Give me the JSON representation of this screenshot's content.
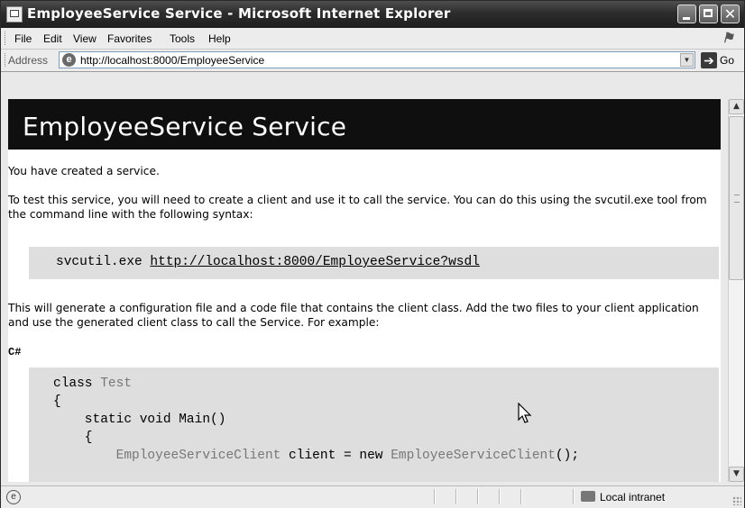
{
  "window": {
    "title": "EmployeeService Service - Microsoft Internet Explorer",
    "minimize_icon": "minimize-icon",
    "maximize_icon": "maximize-icon",
    "close_icon": "close-icon",
    "close_glyph": "✕"
  },
  "menu": {
    "items": [
      {
        "label": "File"
      },
      {
        "label": "Edit"
      },
      {
        "label": "View"
      },
      {
        "label": "Favorites"
      },
      {
        "label": "Tools"
      },
      {
        "label": "Help"
      }
    ]
  },
  "address": {
    "label": "Address",
    "url": "http://localhost:8000/EmployeeService",
    "go_label": "Go",
    "go_glyph": "➔",
    "dropdown_glyph": "▼"
  },
  "page": {
    "heading": "EmployeeService Service",
    "intro": "You have created a service.",
    "test_text": "To test this service, you will need to create a client and use it to call the service. You can do this using the svcutil.exe tool from the command line with the following syntax:",
    "cmd_tool": "svcutil.exe ",
    "cmd_url": "http://localhost:8000/EmployeeService?wsdl",
    "generate_text": "This will generate a configuration file and a code file that contains the client class. Add the two files to your client application and use the generated client class to call the Service. For example:",
    "language_label": "C#",
    "code": {
      "line1_kw": "class ",
      "line1_name": "Test",
      "line2": "{",
      "line3": "    static void Main()",
      "line4": "    {",
      "line5_indent": "        ",
      "line5_type": "EmployeeServiceClient",
      "line5_mid": " client = new ",
      "line5_ctor": "EmployeeServiceClient",
      "line5_end": "();"
    }
  },
  "scrollbar": {
    "up_glyph": "▲",
    "down_glyph": "▼",
    "position": 0.0
  },
  "status": {
    "zone": "Local intranet",
    "page_icon_glyph": "e"
  },
  "colors": {
    "header_bg": "#0f0f0f",
    "code_bg": "#dedede",
    "titlebar": "#2c2c2c"
  }
}
